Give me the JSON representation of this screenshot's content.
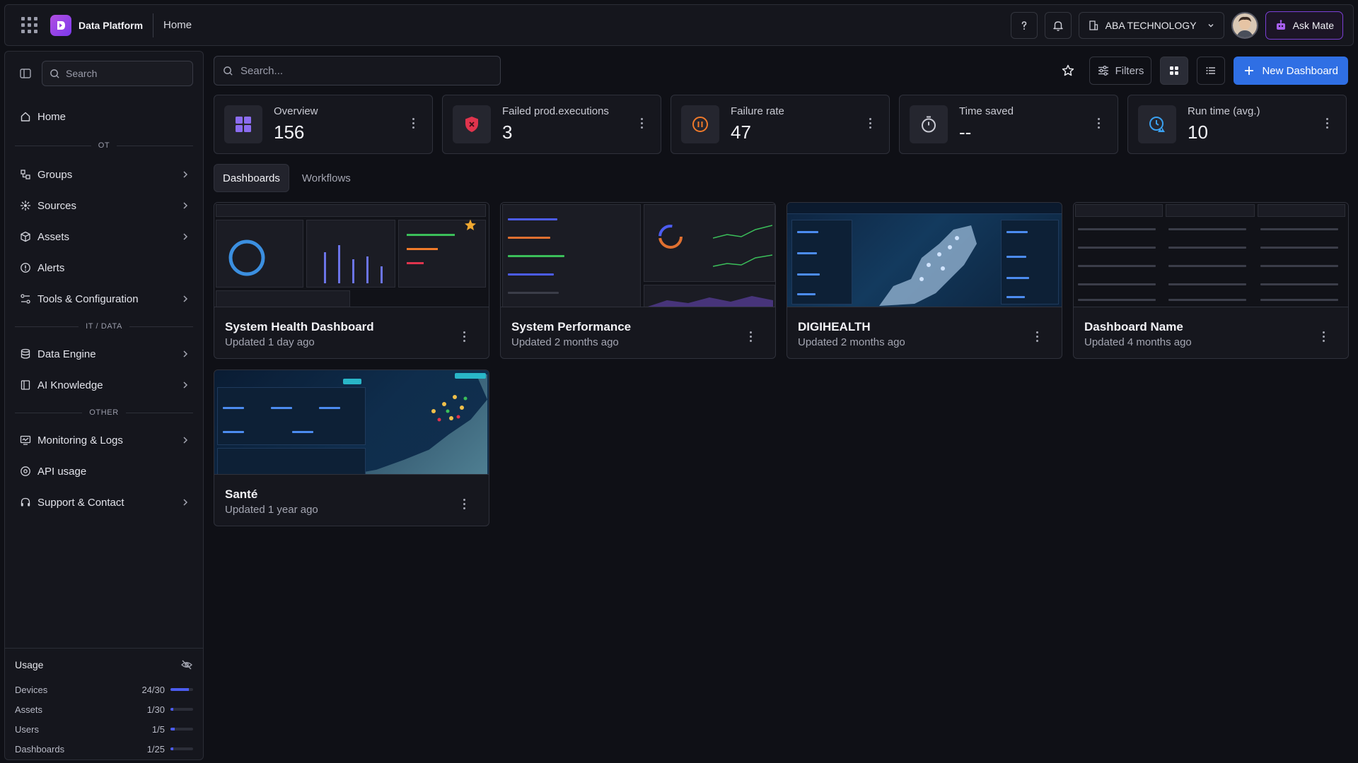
{
  "topbar": {
    "app_title": "Data Platform",
    "breadcrumb": "Home",
    "org_name": "ABA TECHNOLOGY",
    "ask_label": "Ask Mate"
  },
  "sidebar": {
    "search_placeholder": "Search",
    "home": "Home",
    "sections": {
      "ot": "OT",
      "it": "IT / DATA",
      "other": "OTHER"
    },
    "items_ot": [
      "Groups",
      "Sources",
      "Assets",
      "Alerts",
      "Tools & Configuration"
    ],
    "items_it": [
      "Data Engine",
      "AI Knowledge"
    ],
    "items_other": [
      "Monitoring & Logs",
      "API usage",
      "Support & Contact"
    ]
  },
  "usage": {
    "title": "Usage",
    "rows": [
      {
        "label": "Devices",
        "value": "24/30",
        "fraction": 0.8
      },
      {
        "label": "Assets",
        "value": "1/30",
        "fraction": 0.033
      },
      {
        "label": "Users",
        "value": "1/5",
        "fraction": 0.2
      },
      {
        "label": "Dashboards",
        "value": "1/25",
        "fraction": 0.04
      }
    ]
  },
  "toolbar": {
    "search_placeholder": "Search...",
    "filters_label": "Filters",
    "new_dashboard_label": "New Dashboard"
  },
  "stats": [
    {
      "label": "Overview",
      "value": "156",
      "icon": "layout-grid-icon"
    },
    {
      "label": "Failed prod.executions",
      "value": "3",
      "icon": "shield-x-icon"
    },
    {
      "label": "Failure rate",
      "value": "47",
      "icon": "pause-circle-icon"
    },
    {
      "label": "Time saved",
      "value": "--",
      "icon": "stopwatch-icon"
    },
    {
      "label": "Run time (avg.)",
      "value": "10",
      "icon": "clock-alert-icon"
    }
  ],
  "tabs": {
    "dashboards": "Dashboards",
    "workflows": "Workflows"
  },
  "cards": [
    {
      "title": "System Health Dashboard",
      "updated": "Updated 1 day ago"
    },
    {
      "title": "System Performance",
      "updated": "Updated 2 months ago"
    },
    {
      "title": "DIGIHEALTH",
      "updated": "Updated 2 months ago"
    },
    {
      "title": "Dashboard Name",
      "updated": "Updated 4 months ago"
    },
    {
      "title": "Santé",
      "updated": "Updated 1 year ago"
    }
  ],
  "colors": {
    "accent": "#2f6fe4",
    "brand": "#9b45e0",
    "usage_bar": "#4c5cf0",
    "failed_icon": "#e0344d",
    "failure_rate_icon": "#f07a2a",
    "runtime_icon": "#3aa0f0"
  }
}
